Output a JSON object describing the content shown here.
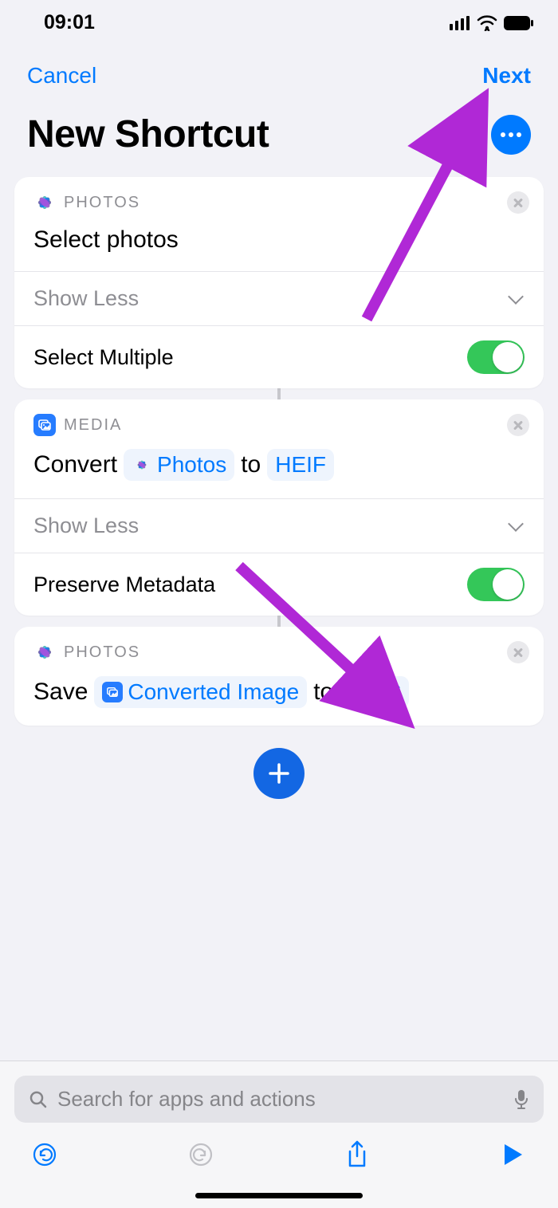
{
  "status": {
    "time": "09:01"
  },
  "nav": {
    "cancel": "Cancel",
    "next": "Next"
  },
  "title": "New Shortcut",
  "cards": {
    "c1": {
      "app": "PHOTOS",
      "title": "Select photos",
      "showless": "Show Less",
      "opt": "Select Multiple"
    },
    "c2": {
      "app": "MEDIA",
      "verb": "Convert",
      "param1": "Photos",
      "mid": "to",
      "param2": "HEIF",
      "showless": "Show Less",
      "opt": "Preserve Metadata"
    },
    "c3": {
      "app": "PHOTOS",
      "verb": "Save",
      "param1": "Converted Image",
      "mid": "to",
      "param2": "HEIC"
    }
  },
  "search": {
    "placeholder": "Search for apps and actions"
  }
}
